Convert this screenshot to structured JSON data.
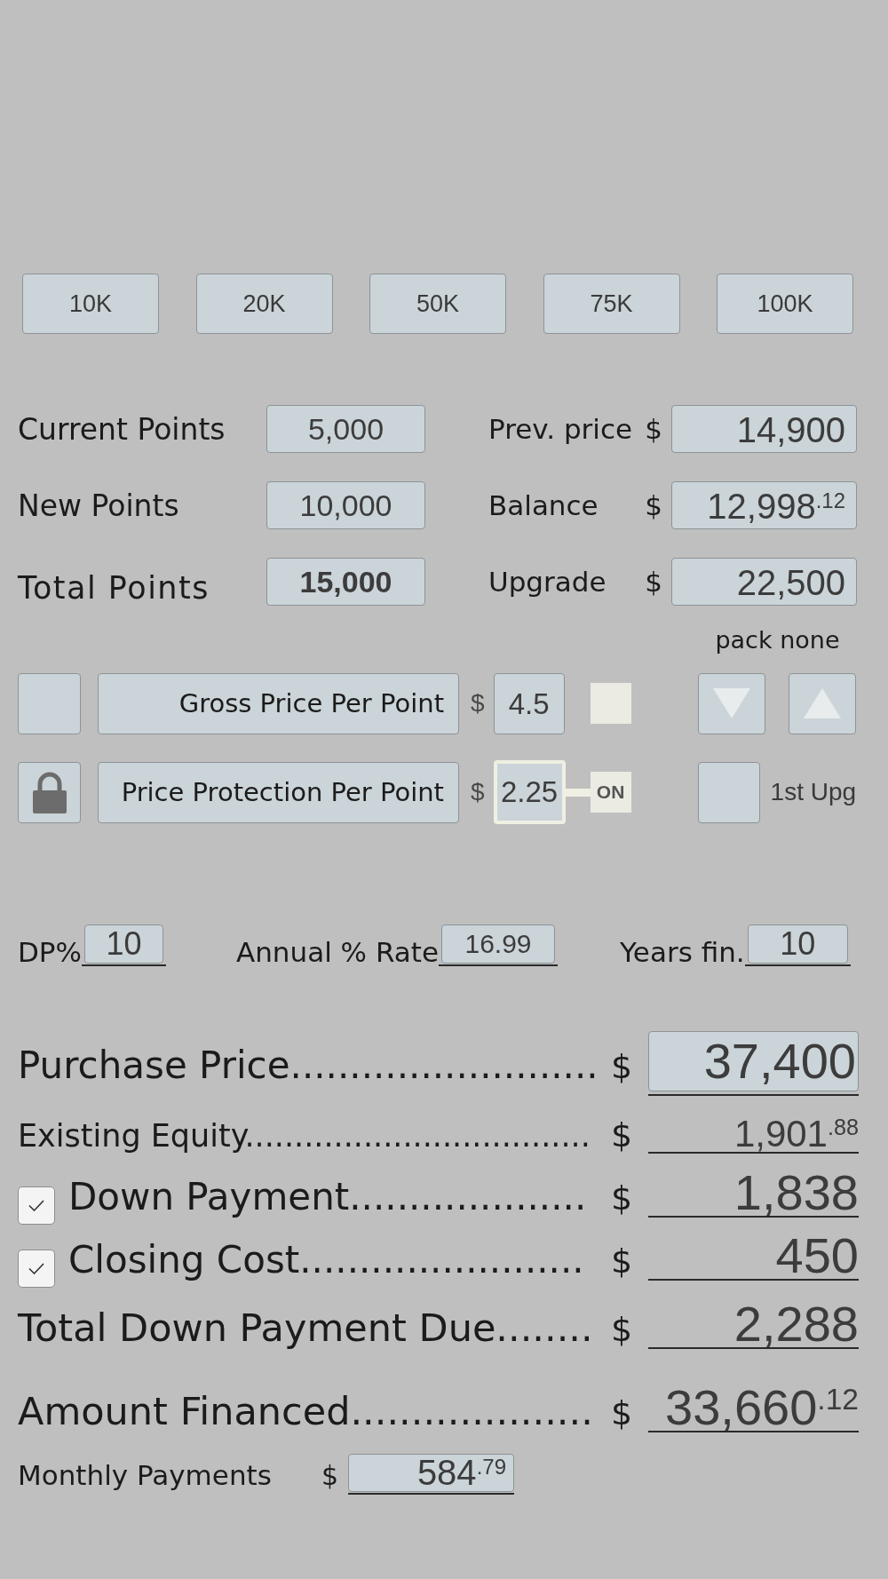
{
  "quick_buttons": [
    "10K",
    "20K",
    "50K",
    "75K",
    "100K"
  ],
  "points": [
    {
      "label": "Current Points",
      "value": "5,000",
      "kind": "input"
    },
    {
      "label": "New Points",
      "value": "10,000",
      "kind": "input"
    },
    {
      "label": "Total Points",
      "value": "15,000",
      "kind": "total"
    }
  ],
  "prices": [
    {
      "label": "Prev. price",
      "currency": "$",
      "value": "14,900"
    },
    {
      "label": "Balance",
      "currency": "$",
      "value": "12,998$^{.12}$"
    },
    {
      "label": "Upgrade",
      "currency": "$",
      "value": "22,500"
    }
  ],
  "pack_label": "pack none",
  "per_point": [
    {
      "label": "Gross Price Per Point",
      "currency": "$",
      "value": "4.5",
      "locked": false,
      "toggle": {
        "on": false
      }
    },
    {
      "label": "Price Protection Per Point",
      "currency": "$",
      "value": "2.25",
      "locked": true,
      "toggle": {
        "on": true,
        "label": "ON"
      }
    }
  ],
  "first_upgrade": {
    "label": "1st Upg",
    "checked": false
  },
  "financing": [
    {
      "label": "DP%",
      "value": "10"
    },
    {
      "label": "Annual % Rate",
      "value": "16.99"
    },
    {
      "label": "Years fin.",
      "value": "10"
    }
  ],
  "summary": [
    {
      "kind": "field",
      "label": "Purchase Price..........................",
      "currency": "$",
      "value": "37,400"
    },
    {
      "kind": "plain",
      "label": "Existing Equity...................................",
      "currency": "$",
      "value": "1,901$^{.88}$"
    },
    {
      "kind": "check",
      "checked": true,
      "label": "Down Payment....................",
      "currency": "$",
      "value": "1,838"
    },
    {
      "kind": "check",
      "checked": true,
      "label": "Closing Cost........................",
      "currency": "$",
      "value": "450"
    },
    {
      "kind": "plain",
      "label": "Total Down Payment Due........",
      "currency": "$",
      "value": "2,288"
    },
    {
      "kind": "plain",
      "label": "Amount Financed....................",
      "currency": "$",
      "value": "33,660$^{.12}$"
    }
  ],
  "monthly": {
    "label": "Monthly Payments",
    "currency": "$",
    "value": "584$^{.79}$"
  }
}
